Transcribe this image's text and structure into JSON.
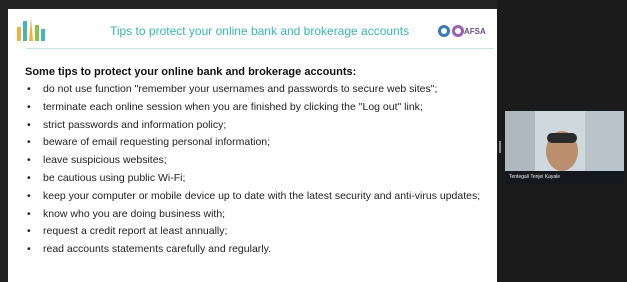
{
  "slide": {
    "title": "Tips to protect your online bank and brokerage accounts",
    "right_logo_text": "AFSA",
    "heading": "Some tips to protect your online bank and brokerage accounts:",
    "bullet_glyph": "•",
    "tips": [
      "do not use function \"remember your usernames and passwords to secure web sites\";",
      "terminate each online session when you are finished by clicking the \"Log out\" link;",
      "strict passwords and information policy;",
      "beware of email requesting personal information;",
      "leave suspicious websites;",
      "be cautious using public Wi-Fi;",
      "keep your computer or mobile device up to date with the latest security and anti-virus updates;",
      "know who you are doing business with;",
      "request a credit report at least annually;",
      "read accounts statements carefully and regularly."
    ]
  },
  "participant": {
    "name": "Tentegali Tenjei Kayale"
  },
  "colors": {
    "title": "#39b5b5",
    "background": "#232323",
    "afsa": "#6e4b8a"
  }
}
